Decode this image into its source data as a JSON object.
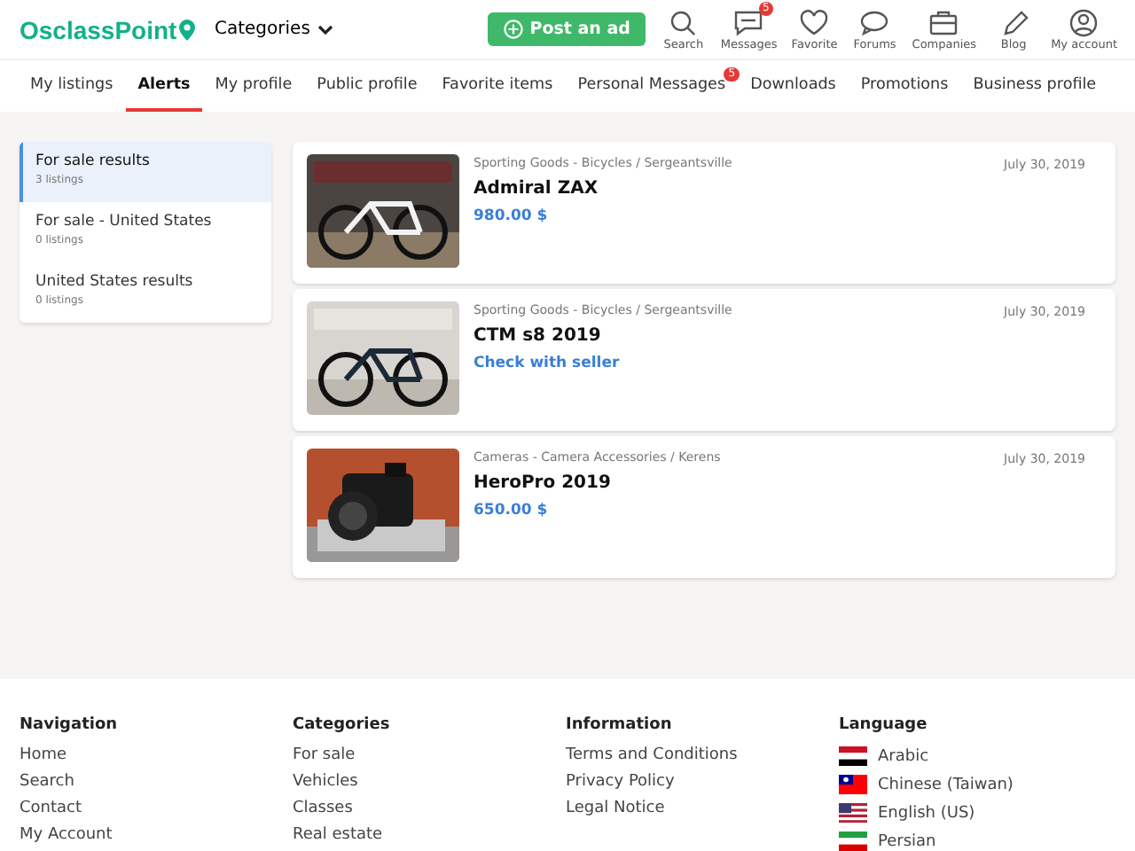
{
  "logo": {
    "text": "OsclassPoint"
  },
  "categories_menu": {
    "label": "Categories"
  },
  "post_button": {
    "label": "Post an ad"
  },
  "header_icons": [
    {
      "kind": "search",
      "label": "Search"
    },
    {
      "kind": "messages",
      "label": "Messages",
      "badge": "5"
    },
    {
      "kind": "favorite",
      "label": "Favorite"
    },
    {
      "kind": "forums",
      "label": "Forums"
    },
    {
      "kind": "companies",
      "label": "Companies"
    },
    {
      "kind": "blog",
      "label": "Blog"
    },
    {
      "kind": "account",
      "label": "My account"
    }
  ],
  "tabs": [
    {
      "label": "My listings",
      "selected": false
    },
    {
      "label": "Alerts",
      "selected": true
    },
    {
      "label": "My profile",
      "selected": false
    },
    {
      "label": "Public profile",
      "selected": false
    },
    {
      "label": "Favorite items",
      "selected": false
    },
    {
      "label": "Personal Messages",
      "selected": false,
      "badge": "5"
    },
    {
      "label": "Downloads",
      "selected": false
    },
    {
      "label": "Promotions",
      "selected": false
    },
    {
      "label": "Business profile",
      "selected": false
    }
  ],
  "alerts": [
    {
      "name": "For sale results",
      "count": "3 listings",
      "selected": true
    },
    {
      "name": "For sale - United States",
      "count": "0 listings",
      "selected": false
    },
    {
      "name": "United States results",
      "count": "0 listings",
      "selected": false
    }
  ],
  "listings": [
    {
      "kind": "picture",
      "category": "Sporting Goods - Bicycles / Sergeantsville",
      "title": "Admiral ZAX",
      "price": "980.00 $",
      "date": "July 30, 2019"
    },
    {
      "kind": "picture",
      "category": "Sporting Goods - Bicycles / Sergeantsville",
      "title": "CTM s8 2019",
      "price": "Check with seller",
      "date": "July 30, 2019"
    },
    {
      "kind": "picture",
      "category": "Cameras - Camera Accessories / Kerens",
      "title": "HeroPro 2019",
      "price": "650.00 $",
      "date": "July 30, 2019"
    }
  ],
  "footer": {
    "columns": [
      {
        "heading": "Navigation",
        "links": [
          "Home",
          "Search",
          "Contact",
          "My Account"
        ]
      },
      {
        "heading": "Categories",
        "links": [
          "For sale",
          "Vehicles",
          "Classes",
          "Real estate"
        ]
      },
      {
        "heading": "Information",
        "links": [
          "Terms and Conditions",
          "Privacy Policy",
          "Legal Notice"
        ]
      }
    ],
    "language": {
      "heading": "Language",
      "items": [
        {
          "label": "Arabic",
          "kind": "eg"
        },
        {
          "label": "Chinese (Taiwan)",
          "kind": "tw"
        },
        {
          "label": "English (US)",
          "kind": "us"
        },
        {
          "label": "Persian",
          "kind": "ir"
        }
      ]
    }
  }
}
